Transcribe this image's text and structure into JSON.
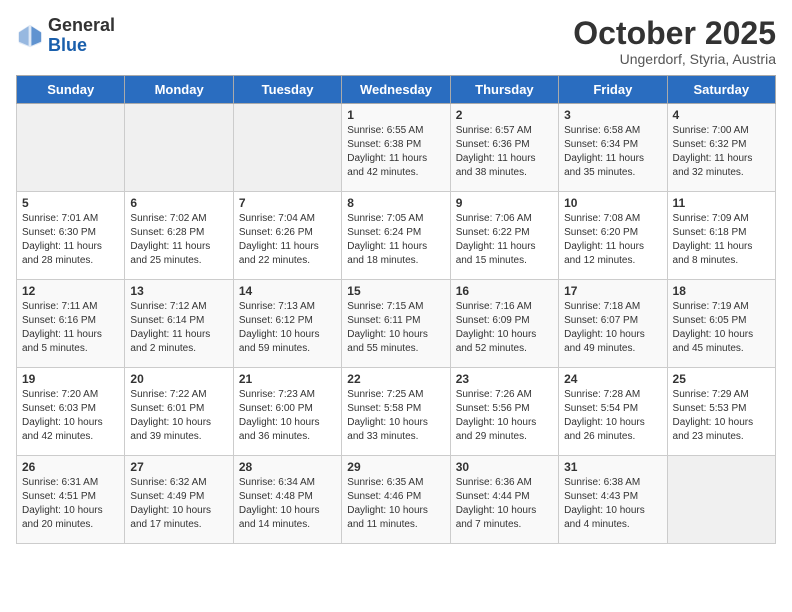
{
  "header": {
    "logo_general": "General",
    "logo_blue": "Blue",
    "month_title": "October 2025",
    "subtitle": "Ungerdorf, Styria, Austria"
  },
  "days_of_week": [
    "Sunday",
    "Monday",
    "Tuesday",
    "Wednesday",
    "Thursday",
    "Friday",
    "Saturday"
  ],
  "weeks": [
    [
      {
        "day": "",
        "info": ""
      },
      {
        "day": "",
        "info": ""
      },
      {
        "day": "",
        "info": ""
      },
      {
        "day": "1",
        "info": "Sunrise: 6:55 AM\nSunset: 6:38 PM\nDaylight: 11 hours\nand 42 minutes."
      },
      {
        "day": "2",
        "info": "Sunrise: 6:57 AM\nSunset: 6:36 PM\nDaylight: 11 hours\nand 38 minutes."
      },
      {
        "day": "3",
        "info": "Sunrise: 6:58 AM\nSunset: 6:34 PM\nDaylight: 11 hours\nand 35 minutes."
      },
      {
        "day": "4",
        "info": "Sunrise: 7:00 AM\nSunset: 6:32 PM\nDaylight: 11 hours\nand 32 minutes."
      }
    ],
    [
      {
        "day": "5",
        "info": "Sunrise: 7:01 AM\nSunset: 6:30 PM\nDaylight: 11 hours\nand 28 minutes."
      },
      {
        "day": "6",
        "info": "Sunrise: 7:02 AM\nSunset: 6:28 PM\nDaylight: 11 hours\nand 25 minutes."
      },
      {
        "day": "7",
        "info": "Sunrise: 7:04 AM\nSunset: 6:26 PM\nDaylight: 11 hours\nand 22 minutes."
      },
      {
        "day": "8",
        "info": "Sunrise: 7:05 AM\nSunset: 6:24 PM\nDaylight: 11 hours\nand 18 minutes."
      },
      {
        "day": "9",
        "info": "Sunrise: 7:06 AM\nSunset: 6:22 PM\nDaylight: 11 hours\nand 15 minutes."
      },
      {
        "day": "10",
        "info": "Sunrise: 7:08 AM\nSunset: 6:20 PM\nDaylight: 11 hours\nand 12 minutes."
      },
      {
        "day": "11",
        "info": "Sunrise: 7:09 AM\nSunset: 6:18 PM\nDaylight: 11 hours\nand 8 minutes."
      }
    ],
    [
      {
        "day": "12",
        "info": "Sunrise: 7:11 AM\nSunset: 6:16 PM\nDaylight: 11 hours\nand 5 minutes."
      },
      {
        "day": "13",
        "info": "Sunrise: 7:12 AM\nSunset: 6:14 PM\nDaylight: 11 hours\nand 2 minutes."
      },
      {
        "day": "14",
        "info": "Sunrise: 7:13 AM\nSunset: 6:12 PM\nDaylight: 10 hours\nand 59 minutes."
      },
      {
        "day": "15",
        "info": "Sunrise: 7:15 AM\nSunset: 6:11 PM\nDaylight: 10 hours\nand 55 minutes."
      },
      {
        "day": "16",
        "info": "Sunrise: 7:16 AM\nSunset: 6:09 PM\nDaylight: 10 hours\nand 52 minutes."
      },
      {
        "day": "17",
        "info": "Sunrise: 7:18 AM\nSunset: 6:07 PM\nDaylight: 10 hours\nand 49 minutes."
      },
      {
        "day": "18",
        "info": "Sunrise: 7:19 AM\nSunset: 6:05 PM\nDaylight: 10 hours\nand 45 minutes."
      }
    ],
    [
      {
        "day": "19",
        "info": "Sunrise: 7:20 AM\nSunset: 6:03 PM\nDaylight: 10 hours\nand 42 minutes."
      },
      {
        "day": "20",
        "info": "Sunrise: 7:22 AM\nSunset: 6:01 PM\nDaylight: 10 hours\nand 39 minutes."
      },
      {
        "day": "21",
        "info": "Sunrise: 7:23 AM\nSunset: 6:00 PM\nDaylight: 10 hours\nand 36 minutes."
      },
      {
        "day": "22",
        "info": "Sunrise: 7:25 AM\nSunset: 5:58 PM\nDaylight: 10 hours\nand 33 minutes."
      },
      {
        "day": "23",
        "info": "Sunrise: 7:26 AM\nSunset: 5:56 PM\nDaylight: 10 hours\nand 29 minutes."
      },
      {
        "day": "24",
        "info": "Sunrise: 7:28 AM\nSunset: 5:54 PM\nDaylight: 10 hours\nand 26 minutes."
      },
      {
        "day": "25",
        "info": "Sunrise: 7:29 AM\nSunset: 5:53 PM\nDaylight: 10 hours\nand 23 minutes."
      }
    ],
    [
      {
        "day": "26",
        "info": "Sunrise: 6:31 AM\nSunset: 4:51 PM\nDaylight: 10 hours\nand 20 minutes."
      },
      {
        "day": "27",
        "info": "Sunrise: 6:32 AM\nSunset: 4:49 PM\nDaylight: 10 hours\nand 17 minutes."
      },
      {
        "day": "28",
        "info": "Sunrise: 6:34 AM\nSunset: 4:48 PM\nDaylight: 10 hours\nand 14 minutes."
      },
      {
        "day": "29",
        "info": "Sunrise: 6:35 AM\nSunset: 4:46 PM\nDaylight: 10 hours\nand 11 minutes."
      },
      {
        "day": "30",
        "info": "Sunrise: 6:36 AM\nSunset: 4:44 PM\nDaylight: 10 hours\nand 7 minutes."
      },
      {
        "day": "31",
        "info": "Sunrise: 6:38 AM\nSunset: 4:43 PM\nDaylight: 10 hours\nand 4 minutes."
      },
      {
        "day": "",
        "info": ""
      }
    ]
  ]
}
